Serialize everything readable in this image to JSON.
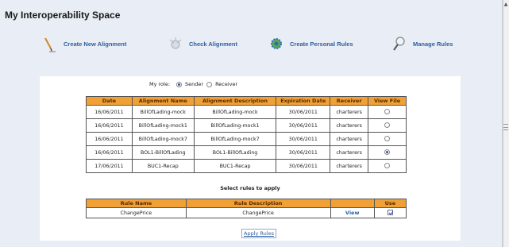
{
  "page": {
    "title": "My Interoperability Space"
  },
  "actions": [
    {
      "label": "Create New Alignment",
      "icon": "pencil-icon"
    },
    {
      "label": "Check Alignment",
      "icon": "check-alignment-icon"
    },
    {
      "label": "Create Personal Rules",
      "icon": "gear-icon"
    },
    {
      "label": "Manage Rules",
      "icon": "magnifier-icon"
    }
  ],
  "role": {
    "label": "My role:",
    "options": [
      "Sender",
      "Receiver"
    ],
    "selected": "Sender"
  },
  "alignments": {
    "headers": [
      "Date",
      "Alignment Name",
      "Alignment Description",
      "Expiration Date",
      "Receiver",
      "View File"
    ],
    "rows": [
      {
        "date": "16/06/2011",
        "name": "BillOfLading-mock",
        "description": "BillOfLading-mock",
        "expiration": "30/06/2011",
        "receiver": "charterers",
        "selected": false
      },
      {
        "date": "16/06/2011",
        "name": "BillOfLading-mock1",
        "description": "BillOfLading-mock1",
        "expiration": "30/06/2011",
        "receiver": "charterers",
        "selected": false
      },
      {
        "date": "16/06/2011",
        "name": "BillOfLading-mock7",
        "description": "BillOfLading-mock7",
        "expiration": "30/06/2011",
        "receiver": "charterers",
        "selected": false
      },
      {
        "date": "16/06/2011",
        "name": "BOL1-BillOfLading",
        "description": "BOL1-BillOfLading",
        "expiration": "30/06/2011",
        "receiver": "charterers",
        "selected": true
      },
      {
        "date": "17/06/2011",
        "name": "BUC1-Recap",
        "description": "BUC1-Recap",
        "expiration": "30/06/2011",
        "receiver": "charterers",
        "selected": false
      }
    ]
  },
  "rules": {
    "caption": "Select rules to apply",
    "headers": [
      "Rule Name",
      "Rule Description",
      "",
      "Use"
    ],
    "rows": [
      {
        "name": "ChangePrice",
        "description": "ChangePrice",
        "view_label": "View",
        "use": true
      }
    ],
    "apply_label": "Apply Rules"
  },
  "colors": {
    "header_bg": "#f0a035",
    "link": "#2d5fa0",
    "page_bg": "#e9edf5"
  }
}
